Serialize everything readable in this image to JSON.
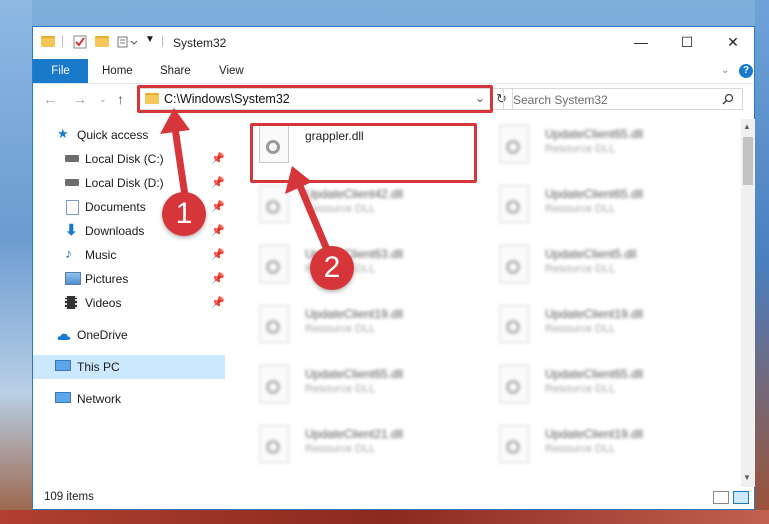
{
  "window": {
    "title": "System32",
    "ribbon_tabs": [
      "File",
      "Home",
      "Share",
      "View"
    ]
  },
  "address": {
    "path": "C:\\Windows\\System32",
    "search_placeholder": "Search System32"
  },
  "sidebar": {
    "items": [
      {
        "label": "Quick access",
        "icon": "star-icon",
        "pinned": false
      },
      {
        "label": "Local Disk (C:)",
        "icon": "drive-icon",
        "pinned": true
      },
      {
        "label": "Local Disk (D:)",
        "icon": "drive-icon",
        "pinned": true
      },
      {
        "label": "Documents",
        "icon": "document-icon",
        "pinned": true
      },
      {
        "label": "Downloads",
        "icon": "download-icon",
        "pinned": true
      },
      {
        "label": "Music",
        "icon": "music-icon",
        "pinned": true
      },
      {
        "label": "Pictures",
        "icon": "pictures-icon",
        "pinned": true
      },
      {
        "label": "Videos",
        "icon": "video-icon",
        "pinned": true
      },
      {
        "label": "OneDrive",
        "icon": "cloud-icon",
        "pinned": false
      },
      {
        "label": "This PC",
        "icon": "computer-icon",
        "pinned": false,
        "selected": true
      },
      {
        "label": "Network",
        "icon": "network-icon",
        "pinned": false
      }
    ]
  },
  "files": [
    {
      "name": "grappler.dll",
      "type": ""
    },
    {
      "name": "UpdateClient65.dll",
      "type": "Resource DLL"
    },
    {
      "name": "UpdateClient42.dll",
      "type": "Resource DLL"
    },
    {
      "name": "UpdateClient65.dll",
      "type": "Resource DLL"
    },
    {
      "name": "UpdateClient63.dll",
      "type": "Resource DLL"
    },
    {
      "name": "UpdateClient5.dll",
      "type": "Resource DLL"
    },
    {
      "name": "UpdateClient19.dll",
      "type": "Resource DLL"
    },
    {
      "name": "UpdateClient19.dll",
      "type": "Resource DLL"
    },
    {
      "name": "UpdateClient65.dll",
      "type": "Resource DLL"
    },
    {
      "name": "UpdateClient65.dll",
      "type": "Resource DLL"
    },
    {
      "name": "UpdateClient21.dll",
      "type": "Resource DLL"
    },
    {
      "name": "UpdateClient19.dll",
      "type": "Resource DLL"
    }
  ],
  "status": {
    "item_count": "109 items"
  },
  "callouts": {
    "first": "1",
    "second": "2"
  },
  "colors": {
    "accent": "#1979ca",
    "highlight": "#d6353a",
    "selected": "#cce8ff"
  }
}
